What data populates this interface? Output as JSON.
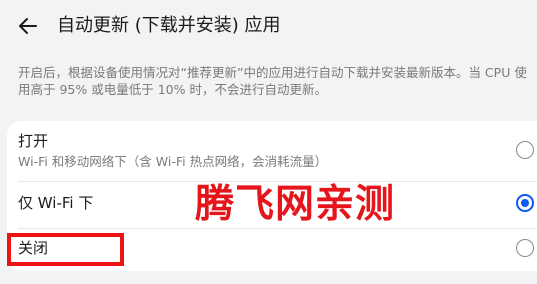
{
  "header": {
    "back_icon": "arrow-left-icon",
    "title": "自动更新 (下载并安装) 应用"
  },
  "description": "开启后，根据设备使用情况对“推荐更新”中的应用进行自动下载并安装最新版本。当 CPU 使用高于 95% 或电量低于 10% 时，不会进行自动更新。",
  "options": [
    {
      "label": "打开",
      "sublabel": "Wi-Fi 和移动网络下（含 Wi-Fi 热点网络，会消耗流量）",
      "selected": false
    },
    {
      "label": "仅 Wi-Fi 下",
      "selected": true
    },
    {
      "label": "关闭",
      "selected": false
    }
  ],
  "overlay": {
    "watermark_text": "腾飞网亲测",
    "watermark_color": "#e4161c",
    "highlight_color": "#ef1414"
  },
  "colors": {
    "accent": "#0a59f7",
    "background": "#f1f3f5"
  }
}
